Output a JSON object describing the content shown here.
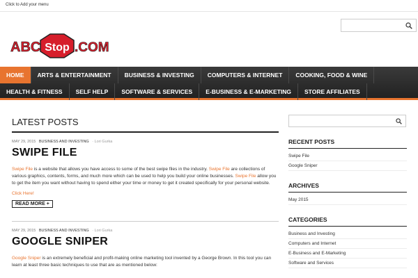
{
  "topbar": {
    "menu_link": "Click to Add your menu"
  },
  "logo": {
    "left": "ABC",
    "middle": "Stop",
    "right": ".COM"
  },
  "search_top": {
    "placeholder": ""
  },
  "nav": {
    "row1": [
      "HOME",
      "ARTS & ENTERTAINMENT",
      "BUSINESS & INVESTING",
      "COMPUTERS & INTERNET",
      "COOKING, FOOD & WINE"
    ],
    "row2": [
      "HEALTH & FITNESS",
      "SELF HELP",
      "SOFTWARE & SERVICES",
      "E-BUSINESS & E-MARKETING",
      "STORE AFFILIATES"
    ]
  },
  "main": {
    "section_title": "LATEST POSTS",
    "posts": [
      {
        "date": "MAY 29, 2015",
        "category": "BUSINESS AND INVESTING",
        "author": "· Lori Gurka",
        "title": "SWIPE FILE",
        "excerpt_parts": [
          {
            "t": "Swipe File",
            "link": true
          },
          {
            "t": " is a website that allows you have access to some of the best swipe files in the industry. ",
            "link": false
          },
          {
            "t": "Swipe File",
            "link": true
          },
          {
            "t": " are collections of various graphics, contents, forms, and much more which can be used to help you build your online businesses. ",
            "link": false
          },
          {
            "t": "Swipe File",
            "link": true
          },
          {
            "t": " allow you to get the item you want without having to spend either your time or money to get it created specifically for your personal website.",
            "link": false
          }
        ],
        "click_here": "Click Here!",
        "read_more": "READ MORE +"
      },
      {
        "date": "MAY 29, 2015",
        "category": "BUSINESS AND INVESTING",
        "author": "· Lori Gurka",
        "title": "GOOGLE SNIPER",
        "excerpt_parts": [
          {
            "t": "Google Sniper",
            "link": true
          },
          {
            "t": " is an extremely beneficial and profit-making online marketing tool invented by a George Brown. In this tool you can learn at least three basic techniques to use that are as mentioned below:",
            "link": false
          }
        ]
      }
    ]
  },
  "sidebar": {
    "search_placeholder": "",
    "recent_posts": {
      "title": "RECENT POSTS",
      "items": [
        "Swipe File",
        "Google Sniper"
      ]
    },
    "archives": {
      "title": "ARCHIVES",
      "items": [
        "May 2015"
      ]
    },
    "categories": {
      "title": "CATEGORIES",
      "items": [
        "Business and Investing",
        "Computers and Internet",
        "E-Business and E-Marketing",
        "Software and Services"
      ]
    }
  },
  "colors": {
    "accent": "#e8742f",
    "nav_bg": "#2b2b2b",
    "logo_red": "#d61e2b"
  },
  "icons": {
    "search": "search-icon"
  }
}
